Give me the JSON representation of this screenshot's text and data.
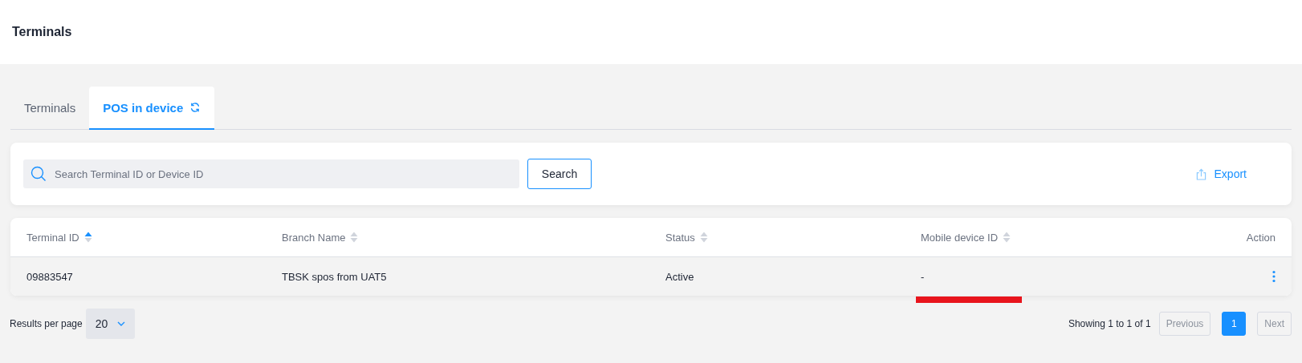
{
  "page_title": "Terminals",
  "tabs": [
    {
      "label": "Terminals",
      "selected": false
    },
    {
      "label": "POS in device",
      "selected": true,
      "refresh": true
    }
  ],
  "search": {
    "placeholder": "Search Terminal ID or Device ID",
    "button": "Search"
  },
  "export": "Export",
  "table": {
    "columns": [
      {
        "label": "Terminal ID",
        "sortable": true,
        "sorted": true
      },
      {
        "label": "Branch Name",
        "sortable": true,
        "sorted": false
      },
      {
        "label": "Status",
        "sortable": true,
        "sorted": false
      },
      {
        "label": "Mobile device ID",
        "sortable": true,
        "sorted": false
      },
      {
        "label": "Action",
        "sortable": false
      }
    ],
    "rows": [
      {
        "cells": [
          {
            "text": "09883547",
            "marked": false
          },
          {
            "text": "TBSK spos from UAT5",
            "marked": false
          },
          {
            "text": "Active",
            "marked": false
          },
          {
            "text": "-",
            "marked": true
          }
        ]
      }
    ]
  },
  "footer": {
    "per_page_label": "Results per page",
    "per_page": "20",
    "showing": "Showing 1 to 1 of 1",
    "pages": [
      {
        "label": "Previous",
        "kind": "nav",
        "disabled": true
      },
      {
        "label": "1",
        "kind": "page",
        "selected": true
      },
      {
        "label": "Next",
        "kind": "nav",
        "disabled": true
      }
    ]
  }
}
